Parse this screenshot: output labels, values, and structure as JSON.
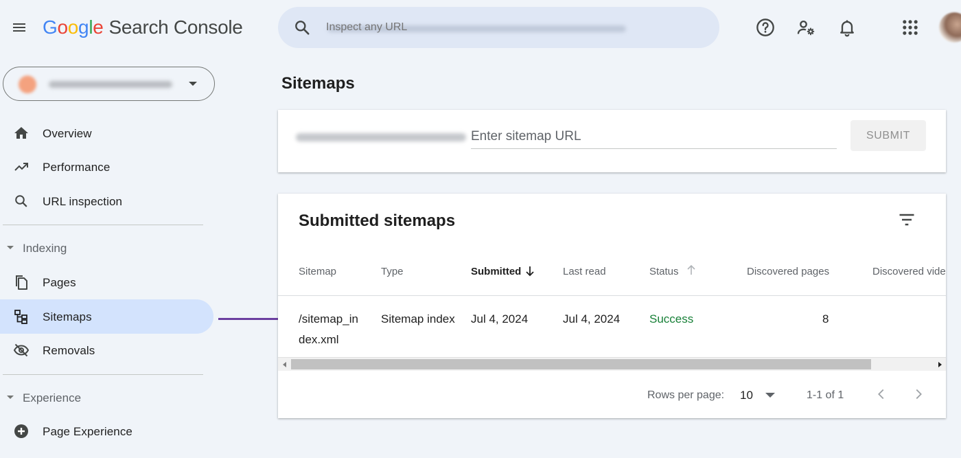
{
  "header": {
    "logo_letters": [
      "G",
      "o",
      "o",
      "g",
      "l",
      "e"
    ],
    "product_name": "Search Console",
    "search_placeholder": "Inspect any URL",
    "icons": [
      "menu-icon",
      "search-icon",
      "help-icon",
      "manage-users-icon",
      "notifications-icon",
      "apps-grid-icon",
      "account-avatar"
    ]
  },
  "property": {
    "icon": "property-favicon",
    "dropdown_icon": "arrow-drop-down-icon"
  },
  "sidebar": {
    "items": [
      {
        "label": "Overview",
        "icon": "home-icon"
      },
      {
        "label": "Performance",
        "icon": "trending-up-icon"
      },
      {
        "label": "URL inspection",
        "icon": "search-icon"
      }
    ],
    "indexing": {
      "heading": "Indexing",
      "items": [
        {
          "label": "Pages",
          "icon": "pages-icon"
        },
        {
          "label": "Sitemaps",
          "icon": "sitemap-icon",
          "active": true
        },
        {
          "label": "Removals",
          "icon": "visibility-off-icon"
        }
      ]
    },
    "experience": {
      "heading": "Experience",
      "items": [
        {
          "label": "Page Experience",
          "icon": "add-circle-icon"
        }
      ]
    }
  },
  "main": {
    "title": "Sitemaps",
    "add_sitemap": {
      "placeholder": "Enter sitemap URL",
      "value": "",
      "submit_label": "SUBMIT"
    },
    "submitted": {
      "title": "Submitted sitemaps",
      "filter_icon": "filter-list-icon",
      "columns": [
        "Sitemap",
        "Type",
        "Submitted",
        "Last read",
        "Status",
        "Discovered pages",
        "Discovered vide"
      ],
      "sorted_column": "Submitted",
      "rows": [
        {
          "sitemap_line1": "/sitemap_in",
          "sitemap_line2": "dex.xml",
          "type": "Sitemap index",
          "submitted": "Jul 4, 2024",
          "last_read": "Jul 4, 2024",
          "status": "Success",
          "discovered_pages": "8"
        }
      ],
      "pagination": {
        "rows_per_page_label": "Rows per page:",
        "rows_per_page": "10",
        "range": "1-1 of 1"
      }
    }
  },
  "annotation": {
    "color": "#6b3fa0",
    "icon": "arrow-right-annotation"
  },
  "colors": {
    "success": "#188038",
    "active_nav": "#d3e3fd",
    "search_bg": "#dfe7f5",
    "page_bg": "#f0f4f9"
  }
}
